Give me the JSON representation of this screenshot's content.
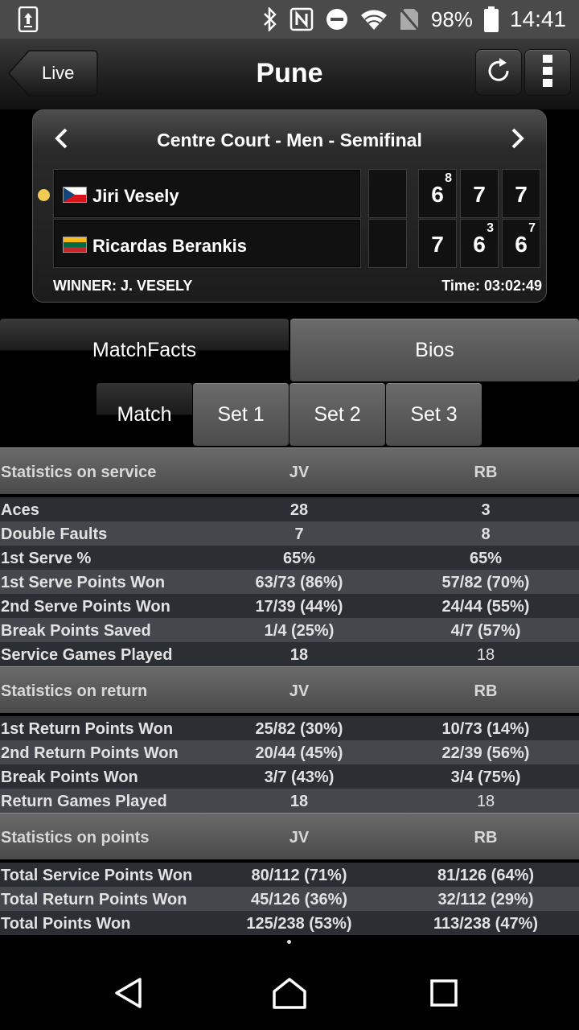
{
  "status_bar": {
    "battery": "98%",
    "time": "14:41",
    "icons": [
      "screenshot-icon",
      "bluetooth-icon",
      "nfc-icon",
      "do-not-disturb-icon",
      "wifi-icon",
      "no-sim-icon",
      "battery-icon"
    ]
  },
  "header": {
    "back_label": "Live",
    "title": "Pune",
    "actions": [
      "refresh-icon",
      "overflow-menu-icon"
    ]
  },
  "match": {
    "court_title": "Centre Court - Men - Semifinal",
    "players": [
      {
        "name": "Jiri Vesely",
        "flag": "Czech Republic",
        "serving": true,
        "sets": [
          {
            "games": "6",
            "tiebreak": "8"
          },
          {
            "games": "7",
            "tiebreak": ""
          },
          {
            "games": "7",
            "tiebreak": ""
          }
        ]
      },
      {
        "name": "Ricardas Berankis",
        "flag": "Lithuania",
        "serving": false,
        "sets": [
          {
            "games": "7",
            "tiebreak": ""
          },
          {
            "games": "6",
            "tiebreak": "3"
          },
          {
            "games": "6",
            "tiebreak": "7"
          }
        ]
      }
    ],
    "winner": "WINNER: J. VESELY",
    "time": "Time: 03:02:49"
  },
  "main_tabs": [
    {
      "label": "MatchFacts",
      "active": true
    },
    {
      "label": "Bios",
      "active": false
    }
  ],
  "sub_tabs": [
    {
      "label": "Match",
      "active": true
    },
    {
      "label": "Set 1",
      "active": false
    },
    {
      "label": "Set 2",
      "active": false
    },
    {
      "label": "Set 3",
      "active": false
    }
  ],
  "stats_sections": [
    {
      "title": "Statistics on service",
      "col1": "JV",
      "col2": "RB",
      "rows": [
        [
          "Aces",
          "28",
          "3"
        ],
        [
          "Double Faults",
          "7",
          "8"
        ],
        [
          "1st Serve %",
          "65%",
          "65%"
        ],
        [
          "1st Serve Points Won",
          "63/73 (86%)",
          "57/82 (70%)"
        ],
        [
          "2nd Serve Points Won",
          "17/39 (44%)",
          "24/44 (55%)"
        ],
        [
          "Break Points Saved",
          "1/4 (25%)",
          "4/7 (57%)"
        ],
        [
          "Service Games Played",
          "18",
          "18"
        ]
      ]
    },
    {
      "title": "Statistics on return",
      "col1": "JV",
      "col2": "RB",
      "rows": [
        [
          "1st Return Points Won",
          "25/82 (30%)",
          "10/73 (14%)"
        ],
        [
          "2nd Return Points Won",
          "20/44 (45%)",
          "22/39 (56%)"
        ],
        [
          "Break Points Won",
          "3/7 (43%)",
          "3/4 (75%)"
        ],
        [
          "Return Games Played",
          "18",
          "18"
        ]
      ]
    },
    {
      "title": "Statistics on points",
      "col1": "JV",
      "col2": "RB",
      "rows": [
        [
          "Total Service Points Won",
          "80/112 (71%)",
          "81/126 (64%)"
        ],
        [
          "Total Return Points Won",
          "45/126 (36%)",
          "32/112 (29%)"
        ],
        [
          "Total Points Won",
          "125/238 (53%)",
          "113/238 (47%)"
        ]
      ]
    }
  ],
  "nav_bar": [
    "back-icon",
    "home-icon",
    "recents-icon"
  ]
}
